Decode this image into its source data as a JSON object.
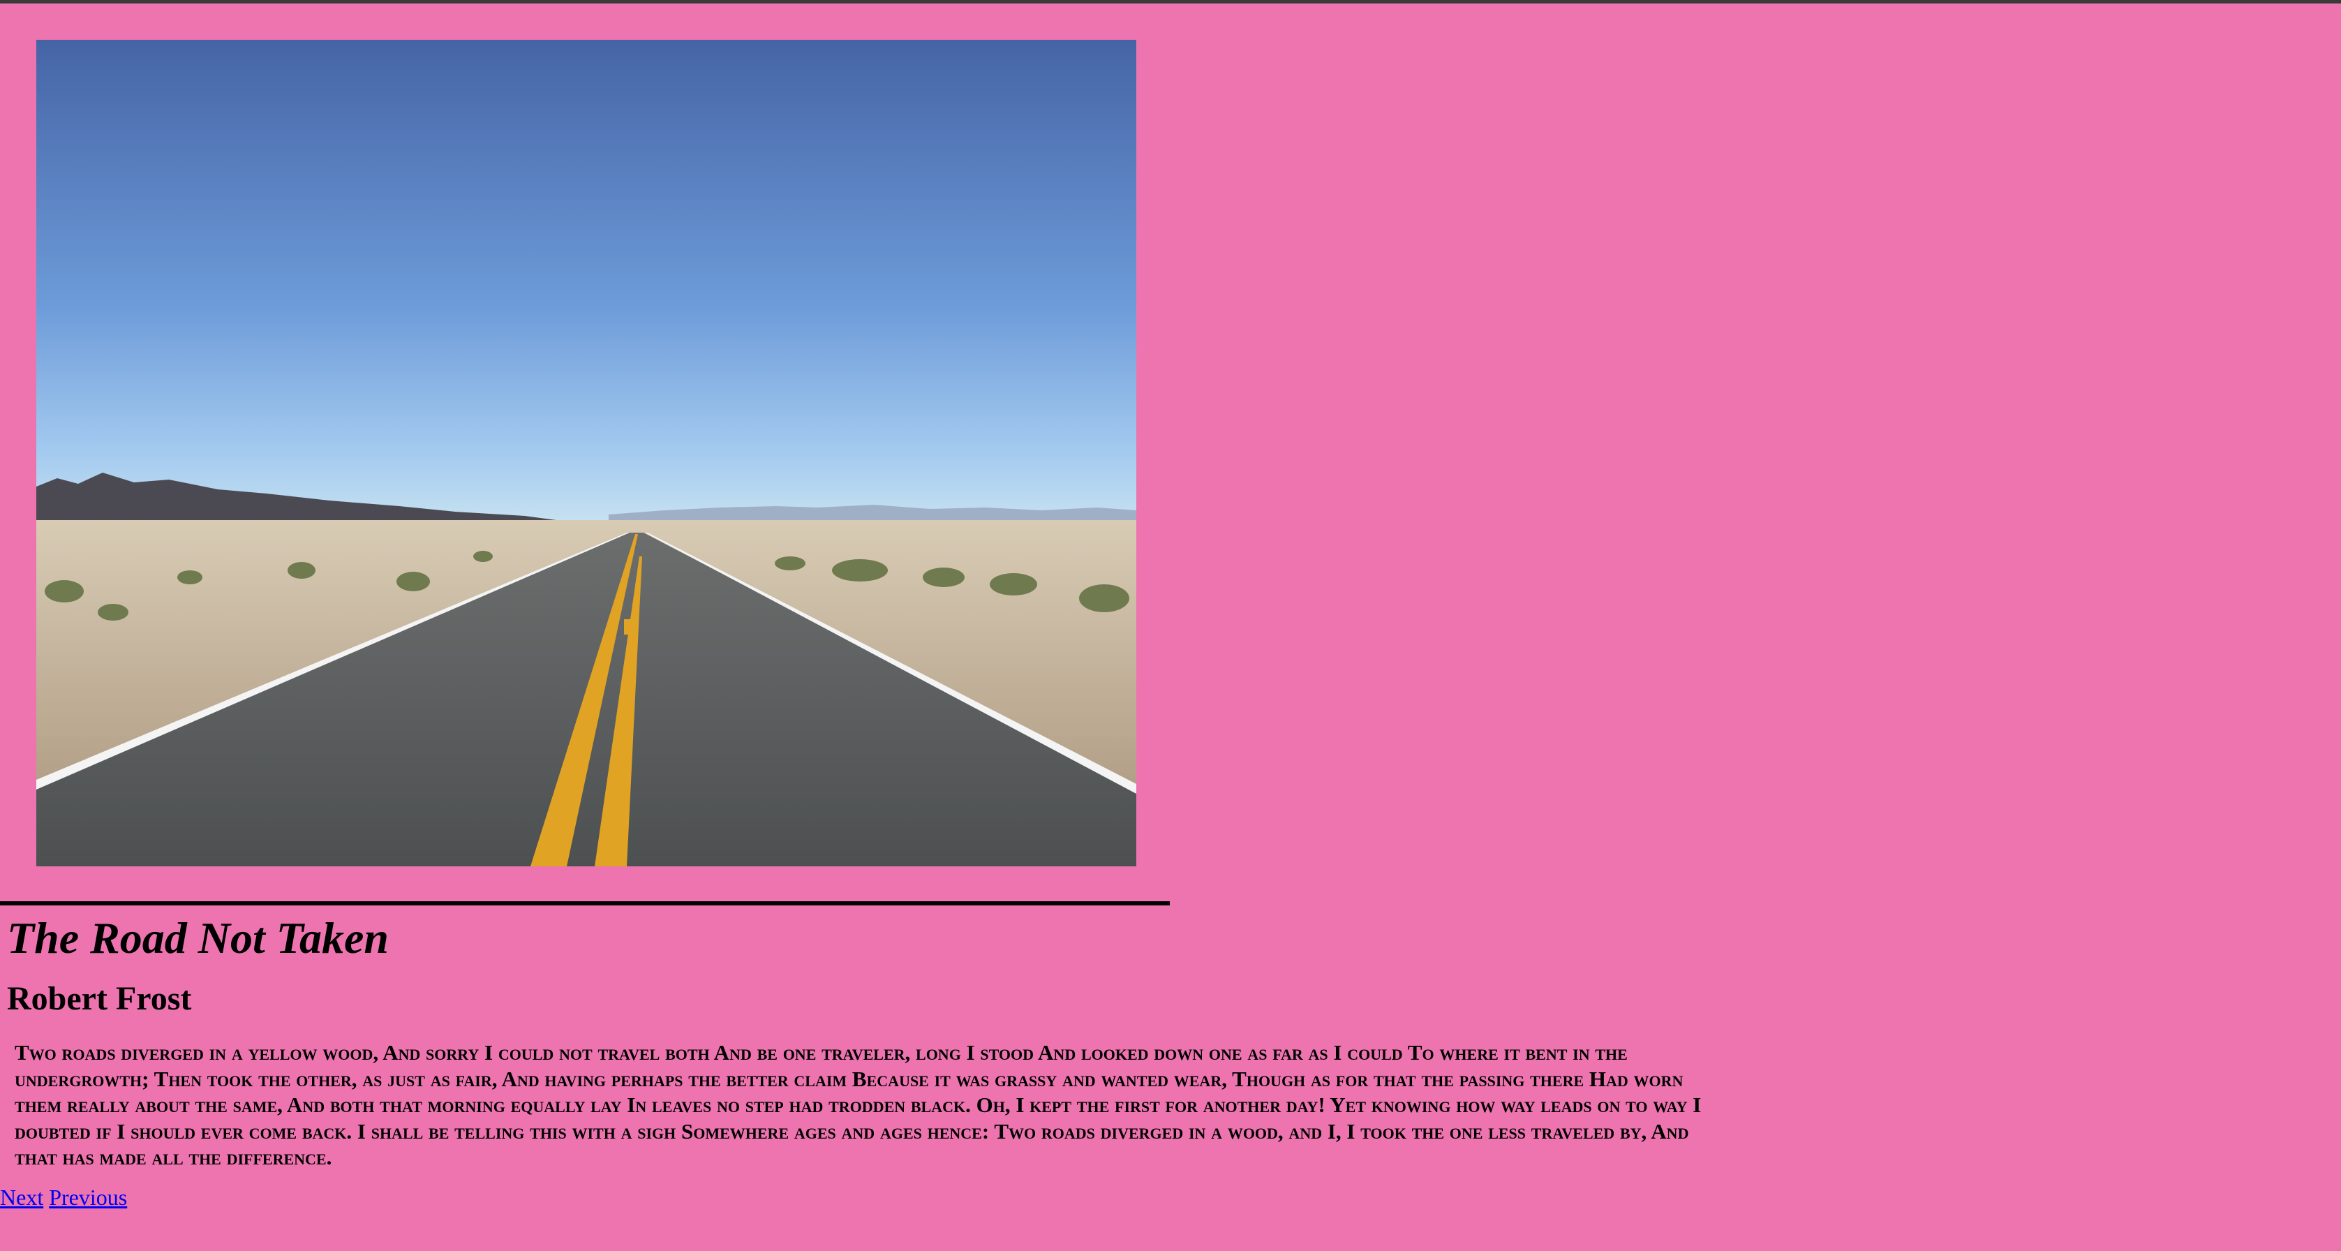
{
  "image": {
    "alt": "",
    "colors": {
      "sky_top": "#4564a6",
      "sky_bottom": "#c6e1f1",
      "mountains": "#4b4a52",
      "desert": "#c8b79e",
      "asphalt": "#56595a",
      "center_line": "#e0a324",
      "edge_line": "#f4f4f4"
    }
  },
  "poem": {
    "title": "The Road Not Taken",
    "author": "Robert Frost",
    "text": "Two roads diverged in a yellow wood, And sorry I could not travel both And be one traveler, long I stood And looked down one as far as I could To where it bent in the undergrowth; Then took the other, as just as fair, And having perhaps the better claim Because it was grassy and wanted wear, Though as for that the passing there Had worn them really about the same, And both that morning equally lay In leaves no step had trodden black. Oh, I kept the first for another day! Yet knowing how way leads on to way I doubted if I should ever come back. I shall be telling this with a sigh Somewhere ages and ages hence: Two roads diverged in a wood, and I, I took the one less traveled by, And that has made all the difference."
  },
  "nav": {
    "next": "Next",
    "previous": "Previous"
  },
  "colors": {
    "background": "#ee74b0",
    "link": "#0000ee",
    "text": "#000000"
  }
}
